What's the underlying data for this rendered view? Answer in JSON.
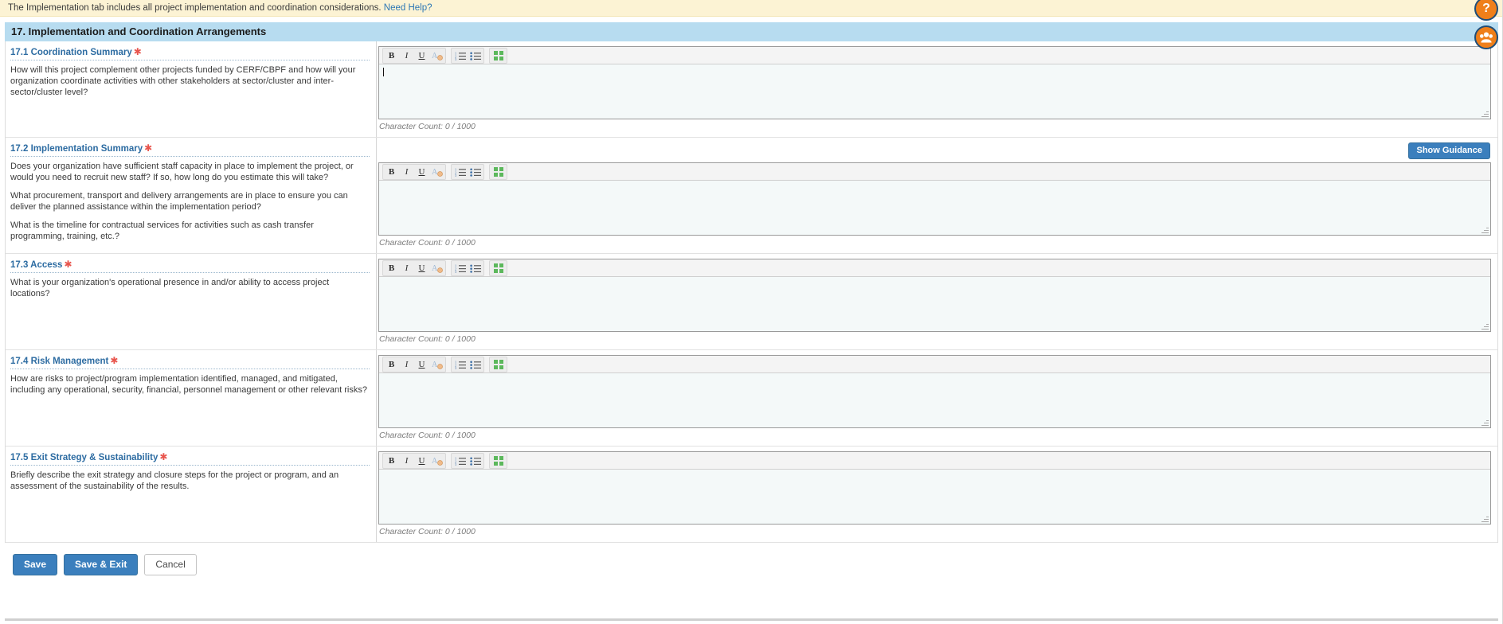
{
  "banner": {
    "text": "The Implementation tab includes all project implementation and coordination considerations.",
    "help_link": "Need Help?"
  },
  "section": {
    "title": "17. Implementation and Coordination Arrangements"
  },
  "toolbar": {
    "bold": "B",
    "italic": "I",
    "underline": "U",
    "remove_format": "A",
    "bullet_list": "bulleted-list-icon",
    "numbered_list": "numbered-list-icon",
    "blocks": "blocks-icon"
  },
  "guidance": {
    "show_label": "Show Guidance"
  },
  "char_count_label": "Character Count: 0 / 1000",
  "questions": [
    {
      "id": "17.1",
      "label": "17.1 Coordination Summary",
      "required": true,
      "has_guidance": false,
      "prompts": [
        "How will this project complement other projects funded by CERF/CBPF and how will your organization coordinate activities with other stakeholders at sector/cluster and inter-sector/cluster level?"
      ],
      "value": "",
      "char_count": "Character Count: 0 / 1000"
    },
    {
      "id": "17.2",
      "label": "17.2 Implementation Summary",
      "required": true,
      "has_guidance": true,
      "prompts": [
        "Does your organization have sufficient staff capacity in place to implement the project, or would you need to recruit new staff? If so, how long do you estimate this will take?",
        "What procurement, transport and delivery arrangements are in place to ensure you can deliver the planned assistance within the implementation period?",
        "What is the timeline for contractual services for activities such as cash transfer programming, training, etc.?"
      ],
      "value": "",
      "char_count": "Character Count: 0 / 1000"
    },
    {
      "id": "17.3",
      "label": "17.3 Access",
      "required": true,
      "has_guidance": false,
      "prompts": [
        "What is your organization's operational presence in and/or ability to access project locations?"
      ],
      "value": "",
      "char_count": "Character Count: 0 / 1000"
    },
    {
      "id": "17.4",
      "label": "17.4 Risk Management",
      "required": true,
      "has_guidance": false,
      "prompts": [
        "How are risks to project/program implementation identified, managed, and mitigated, including any operational, security, financial, personnel management or other relevant risks?"
      ],
      "value": "",
      "char_count": "Character Count: 0 / 1000"
    },
    {
      "id": "17.5",
      "label": "17.5 Exit Strategy & Sustainability",
      "required": true,
      "has_guidance": false,
      "prompts": [
        "Briefly describe the exit strategy and closure steps for the project or program, and an assessment of the sustainability of the results."
      ],
      "value": "",
      "char_count": "Character Count: 0 / 1000"
    }
  ],
  "footer": {
    "save": "Save",
    "save_exit": "Save & Exit",
    "cancel": "Cancel"
  },
  "side_widgets": {
    "help": "?",
    "community": "community-icon"
  },
  "colors": {
    "banner_bg": "#fcf3d4",
    "section_bg": "#b7dcf0",
    "label_blue": "#2d6ca2",
    "required_red": "#e8554d",
    "primary_blue": "#3b7fbd",
    "editor_bg": "#f4f9f9",
    "widget_orange": "#ef7f1a"
  }
}
